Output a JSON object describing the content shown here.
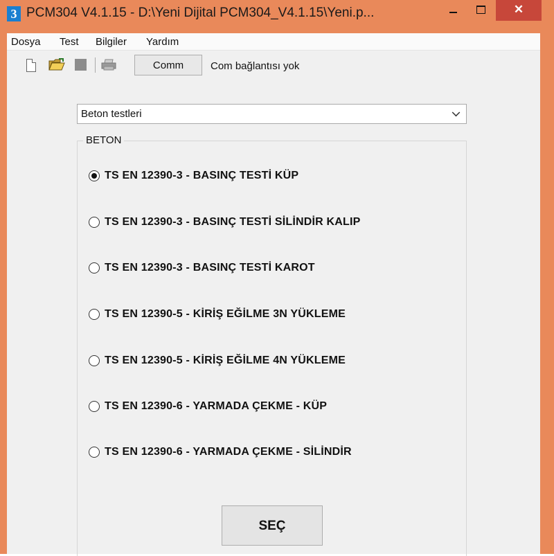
{
  "window": {
    "title": "PCM304 V4.1.15  -  D:\\Yeni Dijital PCM304_V4.1.15\\Yeni.p...",
    "close_glyph": "✕"
  },
  "menu": [
    "Dosya",
    "Test",
    "Bilgiler",
    "Yardım"
  ],
  "toolbar": {
    "icons": [
      "new-file-icon",
      "open-folder-icon",
      "save-icon",
      "print-icon"
    ],
    "comm_label": "Comm",
    "status": "Com bağlantısı yok"
  },
  "dropdown": {
    "selected": "Beton testleri"
  },
  "group": {
    "legend": "BETON",
    "options": [
      {
        "label": "TS EN 12390-3 - BASINÇ TESTİ KÜP",
        "checked": true
      },
      {
        "label": "TS EN 12390-3 - BASINÇ TESTİ SİLİNDİR KALIP",
        "checked": false
      },
      {
        "label": "TS EN 12390-3 - BASINÇ TESTİ KAROT",
        "checked": false
      },
      {
        "label": "TS EN 12390-5 - KİRİŞ EĞİLME 3N YÜKLEME",
        "checked": false
      },
      {
        "label": "TS EN 12390-5 - KİRİŞ EĞİLME 4N YÜKLEME",
        "checked": false
      },
      {
        "label": "TS EN 12390-6 - YARMADA ÇEKME - KÜP",
        "checked": false
      },
      {
        "label": "TS EN 12390-6 - YARMADA ÇEKME - SİLİNDİR",
        "checked": false
      }
    ]
  },
  "select_button": "SEÇ",
  "colors": {
    "frame": "#E9895A",
    "close": "#C7473A",
    "client": "#F0F0F0",
    "app_icon": "#1a7fd0"
  }
}
